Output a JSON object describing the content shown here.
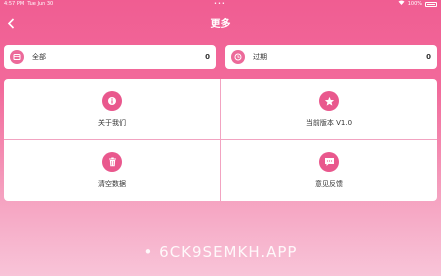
{
  "status_bar": {
    "time": "4:57 PM",
    "date": "Tue Jun 30",
    "dots": "•••",
    "battery": "100%"
  },
  "nav": {
    "title": "更多"
  },
  "cards": [
    {
      "label": "全部",
      "count": "0",
      "icon": "all-icon"
    },
    {
      "label": "过期",
      "count": "0",
      "icon": "clock-icon"
    }
  ],
  "grid": [
    {
      "label": "关于我们",
      "icon": "info-icon"
    },
    {
      "label": "当前版本 V1.0",
      "icon": "star-icon"
    },
    {
      "label": "清空数据",
      "icon": "trash-icon"
    },
    {
      "label": "意见反馈",
      "icon": "chat-icon"
    }
  ],
  "watermark": "• 6CK9SEMKH.APP",
  "colors": {
    "accent": "#e9588d",
    "divider": "#f2a3c1"
  }
}
